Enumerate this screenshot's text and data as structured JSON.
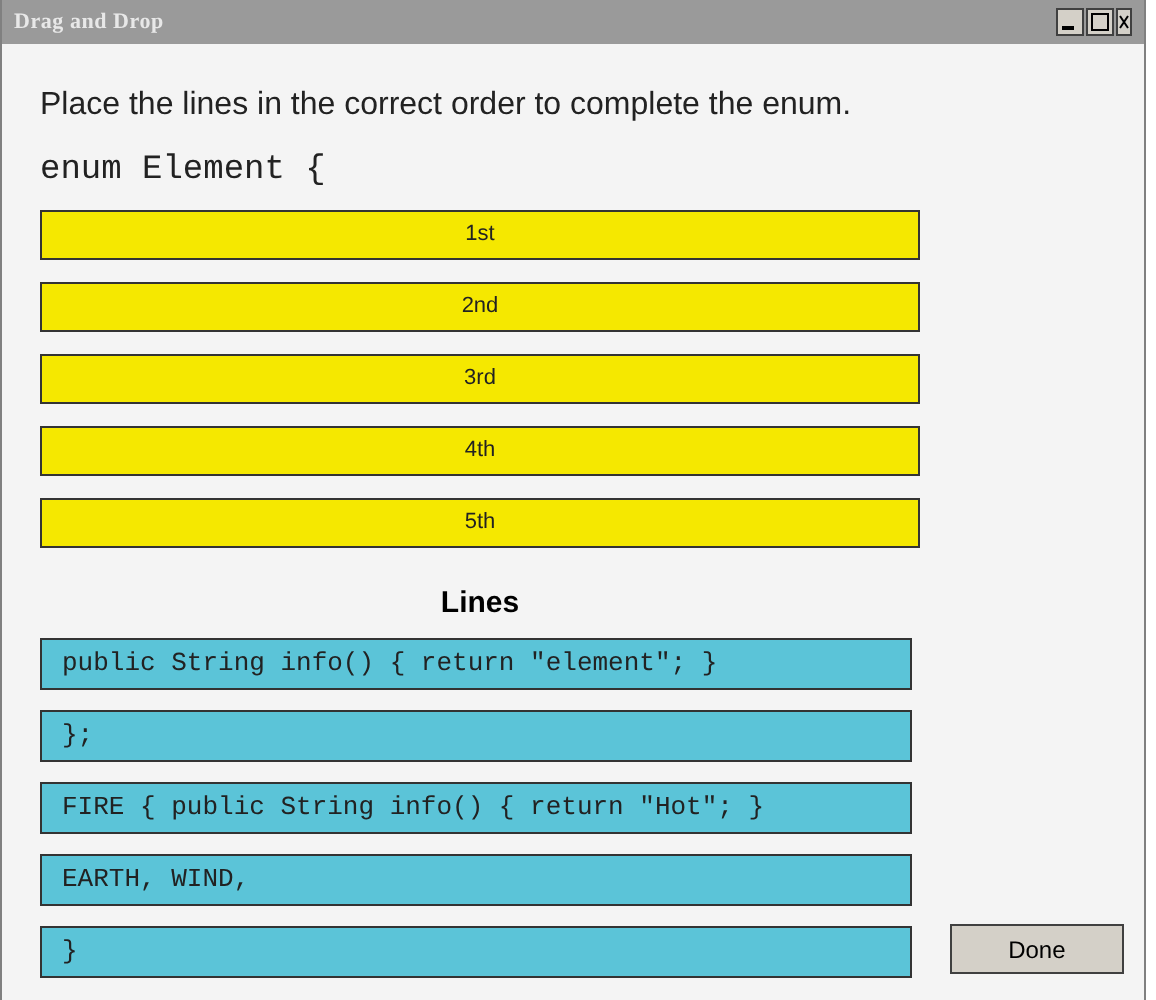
{
  "window": {
    "title": "Drag and Drop"
  },
  "instruction": "Place the lines in the correct order to complete the enum.",
  "code_header": "enum Element {",
  "slots": [
    "1st",
    "2nd",
    "3rd",
    "4th",
    "5th"
  ],
  "lines_heading": "Lines",
  "lines": [
    "public String info() { return \"element\"; }",
    "};",
    "FIRE { public String info() { return \"Hot\"; }",
    "EARTH, WIND,",
    "}"
  ],
  "done_button": "Done"
}
